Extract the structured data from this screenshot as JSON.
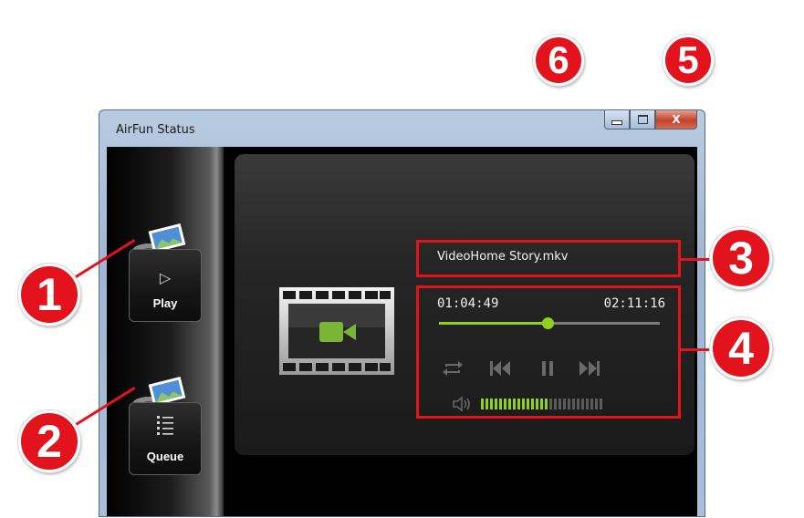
{
  "window": {
    "title": "AirFun Status",
    "close_label": "X"
  },
  "sidebar": {
    "items": [
      {
        "label": "Play",
        "icon": "play-icon"
      },
      {
        "label": "Queue",
        "icon": "list-icon"
      }
    ]
  },
  "player": {
    "file_name": "VideoHome Story.mkv",
    "current_time": "01:04:49",
    "total_time": "02:11:16",
    "progress": 0.49,
    "volume_level": 0.55,
    "controls": [
      "repeat-icon",
      "previous-icon",
      "pause-icon",
      "next-icon"
    ]
  },
  "callouts": [
    "1",
    "2",
    "3",
    "4",
    "5",
    "6"
  ],
  "colors": {
    "accent": "#8fd11d",
    "callout": "#e3131d"
  }
}
